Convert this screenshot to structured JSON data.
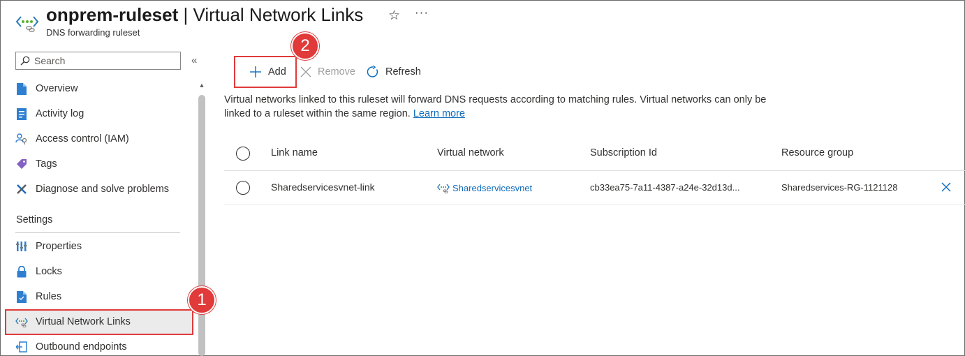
{
  "header": {
    "resource_name": "onprem-ruleset",
    "separator": " | ",
    "page_name": "Virtual Network Links",
    "subtitle": "DNS forwarding ruleset",
    "more_label": "···"
  },
  "sidebar": {
    "search_placeholder": "Search",
    "collapse_label": "«",
    "items": [
      {
        "label": "Overview",
        "icon": "overview-icon"
      },
      {
        "label": "Activity log",
        "icon": "activity-log-icon"
      },
      {
        "label": "Access control (IAM)",
        "icon": "iam-icon"
      },
      {
        "label": "Tags",
        "icon": "tag-icon"
      },
      {
        "label": "Diagnose and solve problems",
        "icon": "wrench-icon"
      }
    ],
    "section_label": "Settings",
    "settings_items": [
      {
        "label": "Properties",
        "icon": "properties-icon"
      },
      {
        "label": "Locks",
        "icon": "lock-icon"
      },
      {
        "label": "Rules",
        "icon": "rules-icon"
      },
      {
        "label": "Virtual Network Links",
        "icon": "vnet-link-icon",
        "selected": true
      },
      {
        "label": "Outbound endpoints",
        "icon": "outbound-endpoint-icon"
      }
    ]
  },
  "callouts": {
    "one": "1",
    "two": "2"
  },
  "toolbar": {
    "add_label": "Add",
    "remove_label": "Remove",
    "refresh_label": "Refresh"
  },
  "description": {
    "text": "Virtual networks linked to this ruleset will forward DNS requests according to matching rules. Virtual networks can only be linked to a ruleset within the same region. ",
    "link_text": "Learn more"
  },
  "table": {
    "columns": [
      "Link name",
      "Virtual network",
      "Subscription Id",
      "Resource group"
    ],
    "rows": [
      {
        "link_name": "Sharedservicesvnet-link",
        "virtual_network": "Sharedservicesvnet",
        "subscription_id": "cb33ea75-7a11-4387-a24e-32d13d...",
        "resource_group": "Sharedservices-RG-1121128"
      }
    ]
  },
  "colors": {
    "accent": "#0f6cbd",
    "highlight_red": "#e03a3a",
    "selected_bg": "#ebebeb"
  }
}
